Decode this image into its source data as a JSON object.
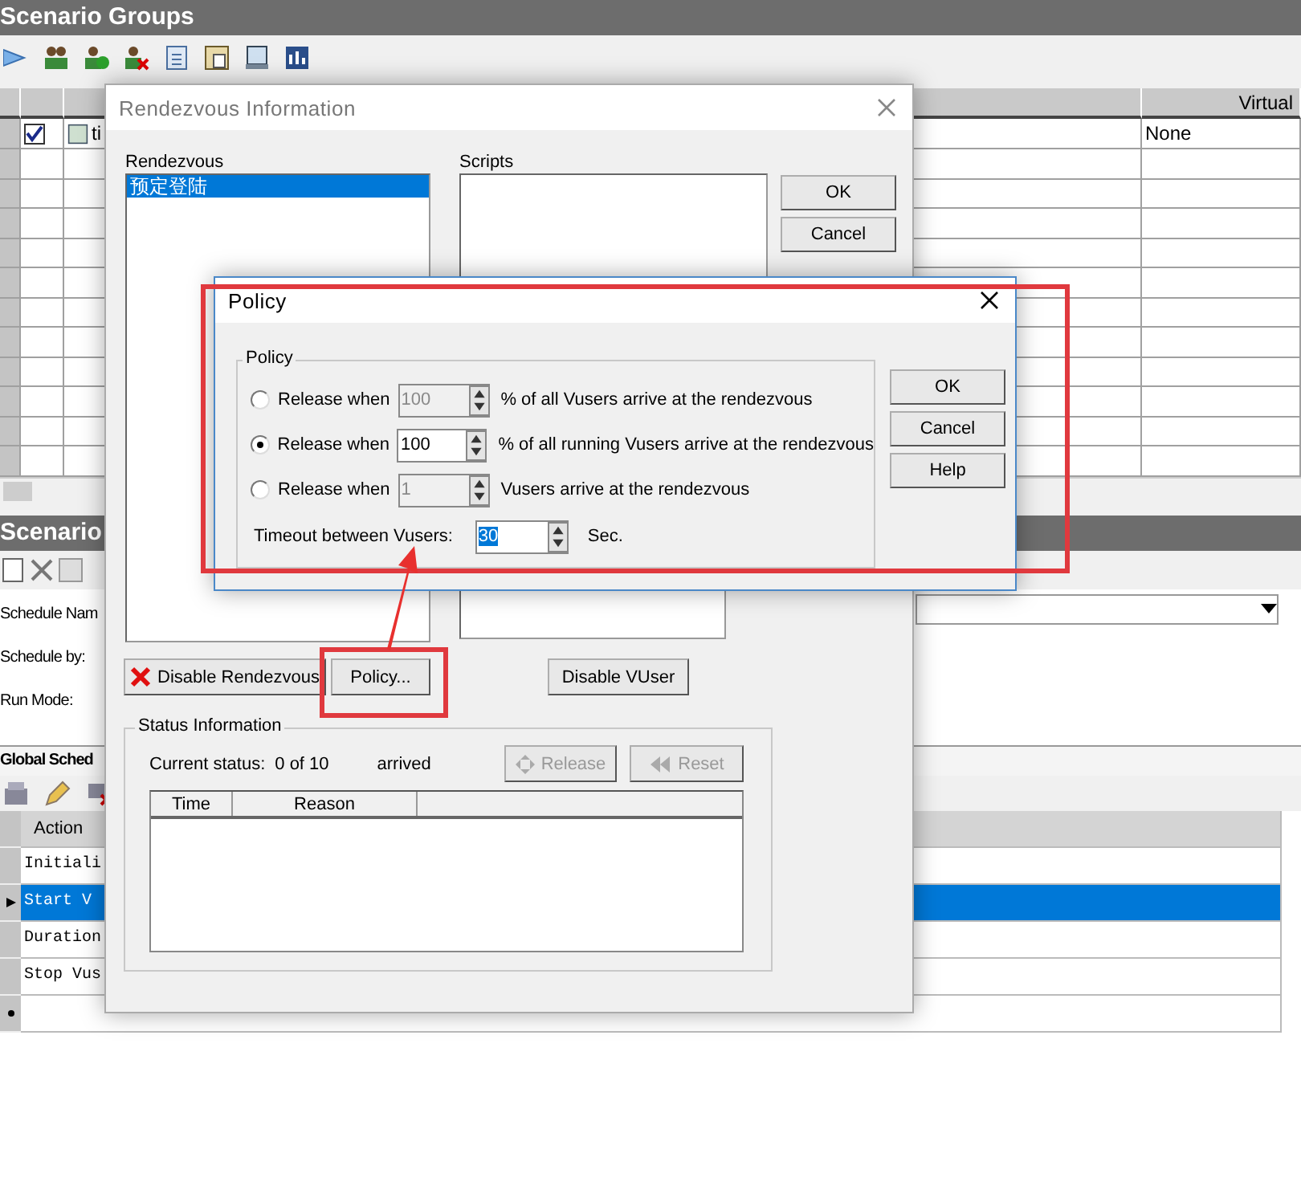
{
  "groups_panel": {
    "title": "Scenario Groups",
    "columns": [
      {
        "label": "Virtual"
      }
    ],
    "rows": [
      {
        "checked": true,
        "name": "ti",
        "column_virtual": "None"
      }
    ]
  },
  "schedule_panel": {
    "title": "Scenario",
    "fields": [
      {
        "label": "Schedule Nam",
        "kind": "dropdown"
      },
      {
        "label": "Schedule by:",
        "kind": "plain"
      },
      {
        "label": "Run Mode:",
        "kind": "plain"
      }
    ],
    "global_schedule": {
      "title": "Global Sched",
      "columns": [
        "Action"
      ],
      "rows": [
        {
          "action": "Initiali",
          "selected": false
        },
        {
          "action": "Start  V",
          "selected": true
        },
        {
          "action": "Duration",
          "selected": false
        },
        {
          "action": "Stop Vus",
          "selected": false
        }
      ]
    }
  },
  "rendezvous_dialog": {
    "title": "Rendezvous Information",
    "rendezvous_label": "Rendezvous",
    "rendezvous_list": [
      {
        "name": "预定登陆",
        "selected": true
      }
    ],
    "scripts_label": "Scripts",
    "buttons": [
      "OK",
      "Cancel"
    ],
    "disable_rendezvous": "Disable Rendezvous",
    "policy_button": "Policy...",
    "disable_vuser": "Disable VUser",
    "status": {
      "title": "Status Information",
      "current_label": "Current status:",
      "count": "0 of 10",
      "arrived": "arrived",
      "release": {
        "label": "Release",
        "disabled": true
      },
      "reset": {
        "label": "Reset",
        "disabled": true
      },
      "columns": [
        "Time",
        "Reason"
      ]
    }
  },
  "policy_dialog": {
    "title": "Policy",
    "group_title": "Policy",
    "options": [
      {
        "label": "Release when",
        "value": "100",
        "suffix": "% of all Vusers arrive at the rendezvous",
        "selected": false
      },
      {
        "label": "Release when",
        "value": "100",
        "suffix": "% of all running Vusers arrive at the rendezvous",
        "selected": true
      },
      {
        "label": "Release when",
        "value": "1",
        "suffix": "Vusers arrive at the rendezvous",
        "selected": false
      }
    ],
    "timeout": {
      "label": "Timeout between Vusers:",
      "value": "30",
      "unit": "Sec."
    },
    "buttons": [
      "OK",
      "Cancel",
      "Help"
    ]
  }
}
